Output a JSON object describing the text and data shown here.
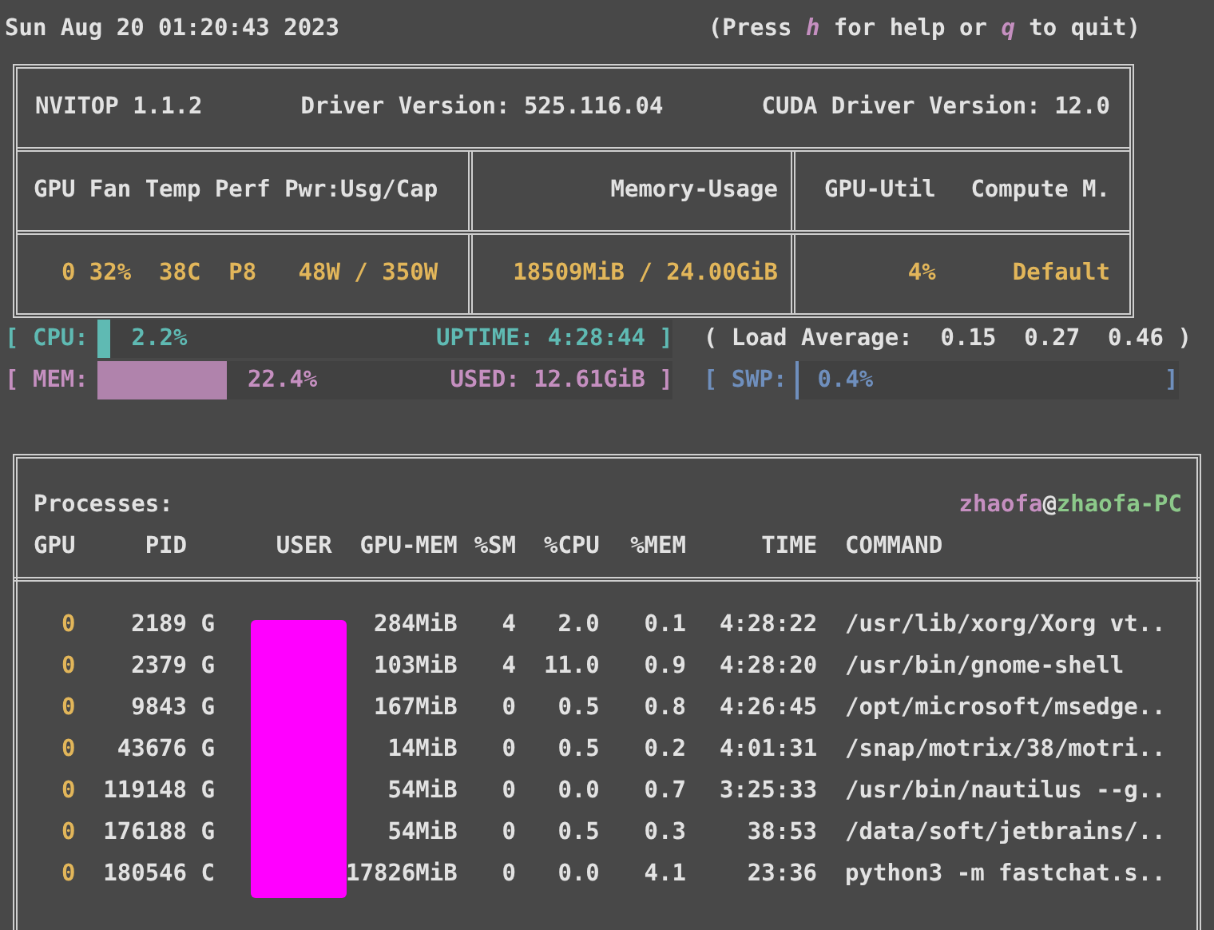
{
  "top_bar": {
    "datetime": "Sun Aug 20 01:20:43 2023",
    "help_parts": [
      {
        "text": "(Press ",
        "kind": "plain"
      },
      {
        "text": "h",
        "kind": "key"
      },
      {
        "text": " for help or ",
        "kind": "plain"
      },
      {
        "text": "q",
        "kind": "key"
      },
      {
        "text": " to quit)",
        "kind": "plain"
      }
    ]
  },
  "gpu_box": {
    "title": "NVITOP 1.1.2",
    "driver_version": "Driver Version: 525.116.04",
    "cuda_version": "CUDA Driver Version: 12.0",
    "columns": [
      "GPU",
      "Fan",
      "Temp",
      "Perf",
      "Pwr:Usg/Cap",
      "Memory-Usage",
      "GPU-Util",
      "Compute M."
    ],
    "row": [
      "0",
      "32%",
      "38C",
      "P8",
      "48W / 350W",
      "18509MiB / 24.00GiB",
      "4%",
      "Default"
    ]
  },
  "meters": {
    "cpu": {
      "label": "[ CPU:",
      "level": 0.022,
      "reading": "2.2%",
      "right": "UPTIME: 4:28:44 ]"
    },
    "load_average": "( Load Average:  0.15  0.27  0.46 )",
    "mem": {
      "label": "[ MEM:",
      "level": 0.224,
      "reading": "22.4%",
      "right": "USED: 12.61GiB ]"
    },
    "swp": {
      "label": "[ SWP:",
      "level": 0.004,
      "reading": "0.4%",
      "close": "]"
    }
  },
  "processes": {
    "title": "Processes:",
    "user": "zhaofa",
    "at": "@",
    "host": "zhaofa-PC",
    "columns": [
      "GPU",
      "PID",
      "",
      "USER",
      "GPU-MEM",
      "%SM",
      "%CPU",
      "%MEM",
      "TIME",
      "COMMAND"
    ],
    "rows": [
      {
        "gpu": "0",
        "pid": "2189",
        "type": "G",
        "gpu_mem": "284MiB",
        "sm": "4",
        "cpu": "2.0",
        "mem": "0.1",
        "time": "4:28:22",
        "command": "/usr/lib/xorg/Xorg vt.."
      },
      {
        "gpu": "0",
        "pid": "2379",
        "type": "G",
        "gpu_mem": "103MiB",
        "sm": "4",
        "cpu": "11.0",
        "mem": "0.9",
        "time": "4:28:20",
        "command": "/usr/bin/gnome-shell"
      },
      {
        "gpu": "0",
        "pid": "9843",
        "type": "G",
        "gpu_mem": "167MiB",
        "sm": "0",
        "cpu": "0.5",
        "mem": "0.8",
        "time": "4:26:45",
        "command": "/opt/microsoft/msedge.."
      },
      {
        "gpu": "0",
        "pid": "43676",
        "type": "G",
        "gpu_mem": "14MiB",
        "sm": "0",
        "cpu": "0.5",
        "mem": "0.2",
        "time": "4:01:31",
        "command": "/snap/motrix/38/motri.."
      },
      {
        "gpu": "0",
        "pid": "119148",
        "type": "G",
        "gpu_mem": "54MiB",
        "sm": "0",
        "cpu": "0.0",
        "mem": "0.7",
        "time": "3:25:33",
        "command": "/usr/bin/nautilus --g.."
      },
      {
        "gpu": "0",
        "pid": "176188",
        "type": "G",
        "gpu_mem": "54MiB",
        "sm": "0",
        "cpu": "0.5",
        "mem": "0.3",
        "time": "38:53",
        "command": "/data/soft/jetbrains/.."
      },
      {
        "gpu": "0",
        "pid": "180546",
        "type": "C",
        "gpu_mem": "17826MiB",
        "sm": "0",
        "cpu": "0.0",
        "mem": "4.1",
        "time": "23:36",
        "command": "python3 -m fastchat.s.."
      }
    ]
  }
}
